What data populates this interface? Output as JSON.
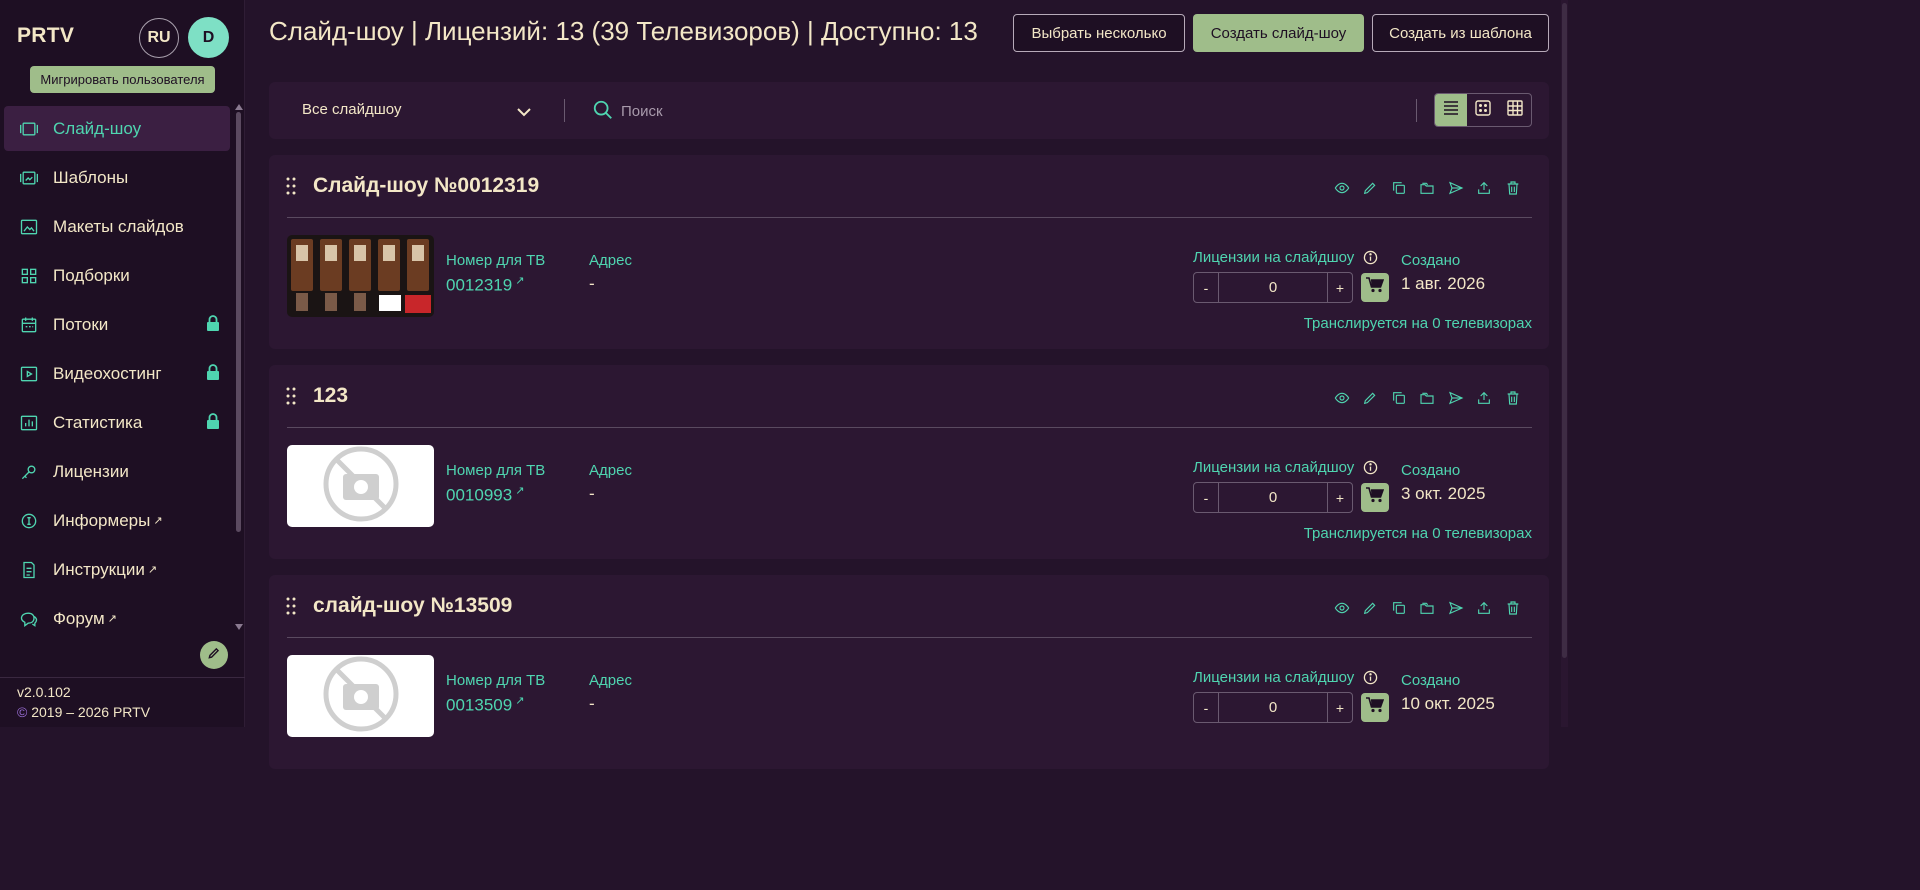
{
  "sidebar": {
    "brand": "PRTV",
    "lang": "RU",
    "avatar": "D",
    "migrate_label": "Мигрировать пользователя",
    "items": [
      {
        "label": "Слайд-шоу",
        "icon": "slideshow-icon",
        "active": true
      },
      {
        "label": "Шаблоны",
        "icon": "templates-icon"
      },
      {
        "label": "Макеты слайдов",
        "icon": "image-icon"
      },
      {
        "label": "Подборки",
        "icon": "grid-icon"
      },
      {
        "label": "Потоки",
        "icon": "calendar-icon",
        "locked": true
      },
      {
        "label": "Видеохостинг",
        "icon": "video-icon",
        "locked": true
      },
      {
        "label": "Статистика",
        "icon": "chart-icon",
        "locked": true
      },
      {
        "label": "Лицензии",
        "icon": "key-icon"
      },
      {
        "label": "Информеры",
        "icon": "info-icon",
        "external": true
      },
      {
        "label": "Инструкции",
        "icon": "document-icon",
        "external": true
      },
      {
        "label": "Форум",
        "icon": "chat-icon",
        "external": true
      }
    ],
    "version": "v2.0.102",
    "copyright_symbol": "©",
    "copyright": "2019 – 2026 PRTV"
  },
  "header": {
    "title": "Слайд-шоу | Лицензий: 13 (39 Телевизоров) | Доступно: 13",
    "select_multiple": "Выбрать несколько",
    "create_slideshow": "Создать слайд-шоу",
    "create_from_template": "Создать из шаблона"
  },
  "filter": {
    "selected": "Все слайдшоу",
    "search_placeholder": "Поиск"
  },
  "labels": {
    "tv_number": "Номер для ТВ",
    "address": "Адрес",
    "licenses": "Лицензии на слайдшоу",
    "created": "Создано"
  },
  "slideshows": [
    {
      "title": "Слайд-шоу №0012319",
      "tv_number": "0012319",
      "address": "-",
      "licenses": "0",
      "created": "1 авг. 2026",
      "broadcast": "Транслируется на 0 телевизорах",
      "has_image": true
    },
    {
      "title": "123",
      "tv_number": "0010993",
      "address": "-",
      "licenses": "0",
      "created": "3 окт. 2025",
      "broadcast": "Транслируется на 0 телевизорах",
      "has_image": false
    },
    {
      "title": "слайд-шоу №13509",
      "tv_number": "0013509",
      "address": "-",
      "licenses": "0",
      "created": "10 окт. 2025",
      "broadcast": "",
      "has_image": false
    }
  ],
  "colors": {
    "accent": "#4fd5b0",
    "green_button": "#9fbd8a",
    "background": "#24132a",
    "card": "#2c1732"
  }
}
